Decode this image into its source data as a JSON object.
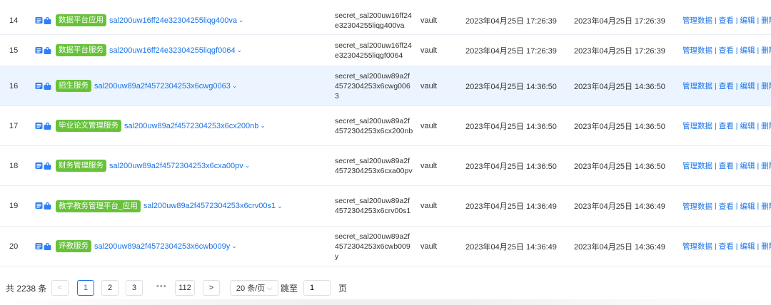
{
  "rows": [
    {
      "idx": "14",
      "tag": "数据平台应用",
      "name": "sal200uw16ff24e32304255liqg400va",
      "secret": "secret_sal200uw16ff24e32304255liqg400va",
      "type": "vault",
      "created": "2023年04月25日 17:26:39",
      "updated": "2023年04月25日 17:26:39"
    },
    {
      "idx": "15",
      "tag": "数据平台服务",
      "name": "sal200uw16ff24e32304255liqgf0064",
      "secret": "secret_sal200uw16ff24e32304255liqgf0064",
      "type": "vault",
      "created": "2023年04月25日 17:26:39",
      "updated": "2023年04月25日 17:26:39"
    },
    {
      "idx": "16",
      "tag": "招生服务",
      "name": "sal200uw89a2f4572304253x6cwg0063",
      "secret": "secret_sal200uw89a2f4572304253x6cwg0063",
      "type": "vault",
      "created": "2023年04月25日 14:36:50",
      "updated": "2023年04月25日 14:36:50"
    },
    {
      "idx": "17",
      "tag": "毕业论文管理服务",
      "name": "sal200uw89a2f4572304253x6cx200nb",
      "secret": "secret_sal200uw89a2f4572304253x6cx200nb",
      "type": "vault",
      "created": "2023年04月25日 14:36:50",
      "updated": "2023年04月25日 14:36:50"
    },
    {
      "idx": "18",
      "tag": "财务管理服务",
      "name": "sal200uw89a2f4572304253x6cxa00pv",
      "secret": "secret_sal200uw89a2f4572304253x6cxa00pv",
      "type": "vault",
      "created": "2023年04月25日 14:36:50",
      "updated": "2023年04月25日 14:36:50"
    },
    {
      "idx": "19",
      "tag": "教学教务管理平台_应用",
      "name": "sal200uw89a2f4572304253x6crv00s1",
      "secret": "secret_sal200uw89a2f4572304253x6crv00s1",
      "type": "vault",
      "created": "2023年04月25日 14:36:49",
      "updated": "2023年04月25日 14:36:49"
    },
    {
      "idx": "20",
      "tag": "评教服务",
      "name": "sal200uw89a2f4572304253x6cwb009y",
      "secret": "secret_sal200uw89a2f4572304253x6cwb009y",
      "type": "vault",
      "created": "2023年04月25日 14:36:49",
      "updated": "2023年04月25日 14:36:49"
    }
  ],
  "ops": {
    "manage": "管理数据",
    "view": "查看",
    "edit": "编辑",
    "delete": "删除",
    "sep": "|"
  },
  "pager": {
    "total": "共 2238 条",
    "prev": "<",
    "next": ">",
    "pages": [
      "1",
      "2",
      "3",
      "112"
    ],
    "dots": "•••",
    "current": "1",
    "page_size": "20 条/页",
    "goto_label": "跳至",
    "goto_value": "1",
    "page_label": "页"
  },
  "colors": {
    "tag_green": "#67c23a",
    "link_blue": "#1a73e8",
    "highlight": "#ecf5ff"
  }
}
